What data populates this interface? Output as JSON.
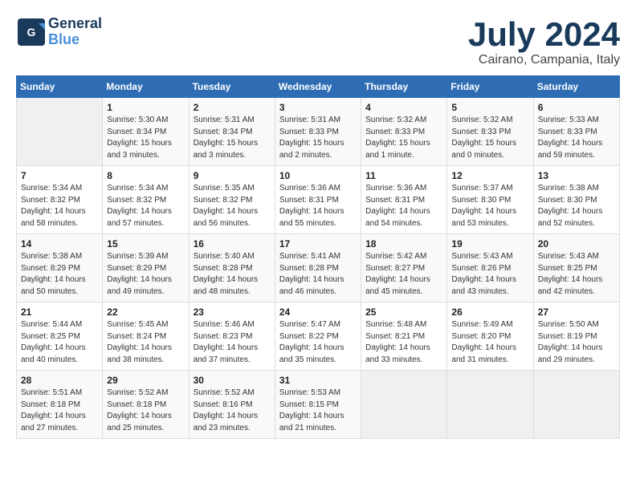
{
  "logo": {
    "line1": "General",
    "line2": "Blue",
    "tagline": ""
  },
  "title": {
    "month_year": "July 2024",
    "location": "Cairano, Campania, Italy"
  },
  "days_of_week": [
    "Sunday",
    "Monday",
    "Tuesday",
    "Wednesday",
    "Thursday",
    "Friday",
    "Saturday"
  ],
  "weeks": [
    [
      {
        "day": "",
        "detail": ""
      },
      {
        "day": "1",
        "detail": "Sunrise: 5:30 AM\nSunset: 8:34 PM\nDaylight: 15 hours\nand 3 minutes."
      },
      {
        "day": "2",
        "detail": "Sunrise: 5:31 AM\nSunset: 8:34 PM\nDaylight: 15 hours\nand 3 minutes."
      },
      {
        "day": "3",
        "detail": "Sunrise: 5:31 AM\nSunset: 8:33 PM\nDaylight: 15 hours\nand 2 minutes."
      },
      {
        "day": "4",
        "detail": "Sunrise: 5:32 AM\nSunset: 8:33 PM\nDaylight: 15 hours\nand 1 minute."
      },
      {
        "day": "5",
        "detail": "Sunrise: 5:32 AM\nSunset: 8:33 PM\nDaylight: 15 hours\nand 0 minutes."
      },
      {
        "day": "6",
        "detail": "Sunrise: 5:33 AM\nSunset: 8:33 PM\nDaylight: 14 hours\nand 59 minutes."
      }
    ],
    [
      {
        "day": "7",
        "detail": "Sunrise: 5:34 AM\nSunset: 8:32 PM\nDaylight: 14 hours\nand 58 minutes."
      },
      {
        "day": "8",
        "detail": "Sunrise: 5:34 AM\nSunset: 8:32 PM\nDaylight: 14 hours\nand 57 minutes."
      },
      {
        "day": "9",
        "detail": "Sunrise: 5:35 AM\nSunset: 8:32 PM\nDaylight: 14 hours\nand 56 minutes."
      },
      {
        "day": "10",
        "detail": "Sunrise: 5:36 AM\nSunset: 8:31 PM\nDaylight: 14 hours\nand 55 minutes."
      },
      {
        "day": "11",
        "detail": "Sunrise: 5:36 AM\nSunset: 8:31 PM\nDaylight: 14 hours\nand 54 minutes."
      },
      {
        "day": "12",
        "detail": "Sunrise: 5:37 AM\nSunset: 8:30 PM\nDaylight: 14 hours\nand 53 minutes."
      },
      {
        "day": "13",
        "detail": "Sunrise: 5:38 AM\nSunset: 8:30 PM\nDaylight: 14 hours\nand 52 minutes."
      }
    ],
    [
      {
        "day": "14",
        "detail": "Sunrise: 5:38 AM\nSunset: 8:29 PM\nDaylight: 14 hours\nand 50 minutes."
      },
      {
        "day": "15",
        "detail": "Sunrise: 5:39 AM\nSunset: 8:29 PM\nDaylight: 14 hours\nand 49 minutes."
      },
      {
        "day": "16",
        "detail": "Sunrise: 5:40 AM\nSunset: 8:28 PM\nDaylight: 14 hours\nand 48 minutes."
      },
      {
        "day": "17",
        "detail": "Sunrise: 5:41 AM\nSunset: 8:28 PM\nDaylight: 14 hours\nand 46 minutes."
      },
      {
        "day": "18",
        "detail": "Sunrise: 5:42 AM\nSunset: 8:27 PM\nDaylight: 14 hours\nand 45 minutes."
      },
      {
        "day": "19",
        "detail": "Sunrise: 5:43 AM\nSunset: 8:26 PM\nDaylight: 14 hours\nand 43 minutes."
      },
      {
        "day": "20",
        "detail": "Sunrise: 5:43 AM\nSunset: 8:25 PM\nDaylight: 14 hours\nand 42 minutes."
      }
    ],
    [
      {
        "day": "21",
        "detail": "Sunrise: 5:44 AM\nSunset: 8:25 PM\nDaylight: 14 hours\nand 40 minutes."
      },
      {
        "day": "22",
        "detail": "Sunrise: 5:45 AM\nSunset: 8:24 PM\nDaylight: 14 hours\nand 38 minutes."
      },
      {
        "day": "23",
        "detail": "Sunrise: 5:46 AM\nSunset: 8:23 PM\nDaylight: 14 hours\nand 37 minutes."
      },
      {
        "day": "24",
        "detail": "Sunrise: 5:47 AM\nSunset: 8:22 PM\nDaylight: 14 hours\nand 35 minutes."
      },
      {
        "day": "25",
        "detail": "Sunrise: 5:48 AM\nSunset: 8:21 PM\nDaylight: 14 hours\nand 33 minutes."
      },
      {
        "day": "26",
        "detail": "Sunrise: 5:49 AM\nSunset: 8:20 PM\nDaylight: 14 hours\nand 31 minutes."
      },
      {
        "day": "27",
        "detail": "Sunrise: 5:50 AM\nSunset: 8:19 PM\nDaylight: 14 hours\nand 29 minutes."
      }
    ],
    [
      {
        "day": "28",
        "detail": "Sunrise: 5:51 AM\nSunset: 8:18 PM\nDaylight: 14 hours\nand 27 minutes."
      },
      {
        "day": "29",
        "detail": "Sunrise: 5:52 AM\nSunset: 8:18 PM\nDaylight: 14 hours\nand 25 minutes."
      },
      {
        "day": "30",
        "detail": "Sunrise: 5:52 AM\nSunset: 8:16 PM\nDaylight: 14 hours\nand 23 minutes."
      },
      {
        "day": "31",
        "detail": "Sunrise: 5:53 AM\nSunset: 8:15 PM\nDaylight: 14 hours\nand 21 minutes."
      },
      {
        "day": "",
        "detail": ""
      },
      {
        "day": "",
        "detail": ""
      },
      {
        "day": "",
        "detail": ""
      }
    ]
  ]
}
